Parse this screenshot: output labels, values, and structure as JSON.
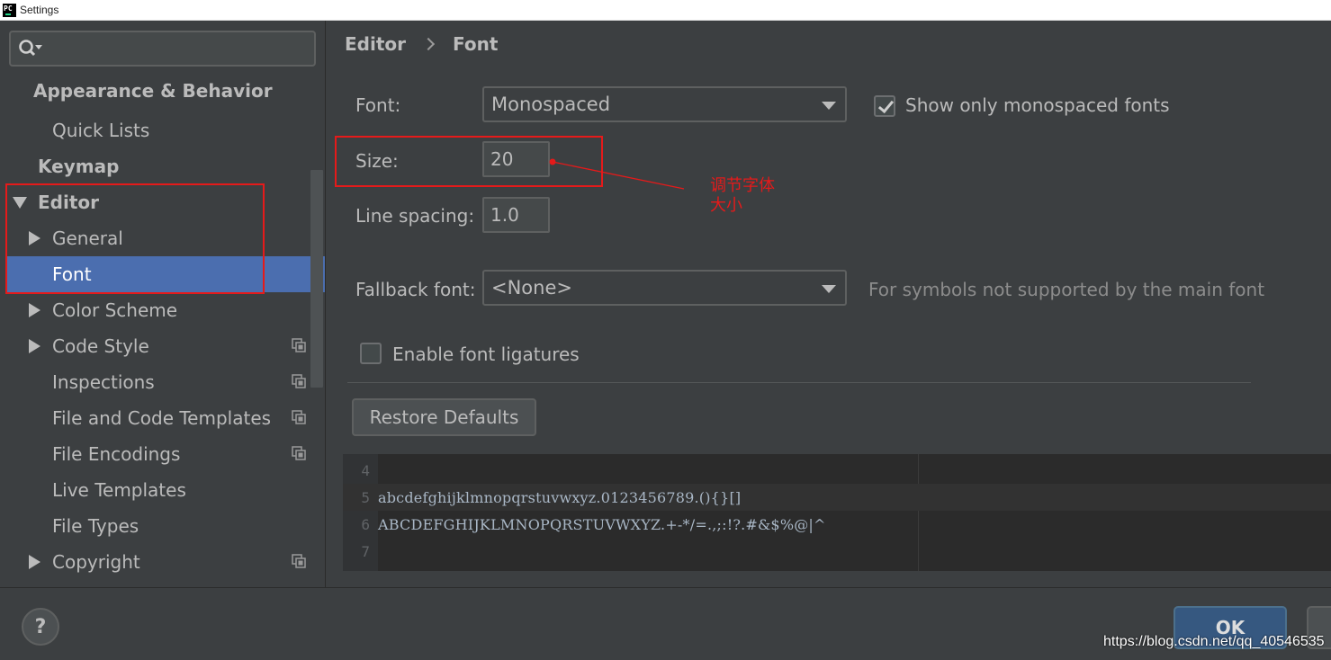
{
  "window": {
    "title": "Settings",
    "logo_text": "PC"
  },
  "sidebar": {
    "search": {
      "placeholder": "",
      "icon": "search-icon"
    },
    "items": [
      {
        "label": "Appearance & Behavior",
        "type": "group",
        "expanded": false
      },
      {
        "label": "Quick Lists",
        "type": "item"
      },
      {
        "label": "Keymap",
        "type": "group"
      },
      {
        "label": "Editor",
        "type": "group",
        "expanded": true
      },
      {
        "label": "General",
        "type": "item",
        "expandable": true
      },
      {
        "label": "Font",
        "type": "item",
        "selected": true
      },
      {
        "label": "Color Scheme",
        "type": "item",
        "expandable": true
      },
      {
        "label": "Code Style",
        "type": "item",
        "expandable": true,
        "project_icon": true
      },
      {
        "label": "Inspections",
        "type": "item",
        "project_icon": true
      },
      {
        "label": "File and Code Templates",
        "type": "item",
        "project_icon": true
      },
      {
        "label": "File Encodings",
        "type": "item",
        "project_icon": true
      },
      {
        "label": "Live Templates",
        "type": "item"
      },
      {
        "label": "File Types",
        "type": "item"
      },
      {
        "label": "Copyright",
        "type": "item",
        "expandable": true,
        "project_icon": true
      }
    ]
  },
  "breadcrumb": [
    "Editor",
    "Font"
  ],
  "font_settings": {
    "font_label": "Font:",
    "font_value": "Monospaced",
    "monospaced_only_label": "Show only monospaced fonts",
    "monospaced_only_checked": true,
    "size_label": "Size:",
    "size_value": "20",
    "line_spacing_label": "Line spacing:",
    "line_spacing_value": "1.0",
    "fallback_label": "Fallback font:",
    "fallback_value": "<None>",
    "fallback_hint": "For symbols not supported by the main font",
    "ligatures_label": "Enable font ligatures",
    "ligatures_checked": false,
    "restore_label": "Restore Defaults"
  },
  "preview": {
    "lines": [
      {
        "num": "4",
        "text": ""
      },
      {
        "num": "5",
        "text": "abcdefghijklmnopqrstuvwxyz.0123456789.(){}[]"
      },
      {
        "num": "6",
        "text": "ABCDEFGHIJKLMNOPQRSTUVWXYZ.+-*/=.,;:!?.#&$%@|^"
      },
      {
        "num": "7",
        "text": ""
      }
    ]
  },
  "annotation": {
    "line1": "调节字体",
    "line2": "大小",
    "color": "#e51a1a"
  },
  "footer": {
    "help_label": "?",
    "ok_label": "OK",
    "watermark": "https://blog.csdn.net/qq_40546535"
  },
  "colors": {
    "background": "#3c3f41",
    "selection": "#4b6eaf",
    "text": "#bbbbbb",
    "accent_button": "#365880"
  }
}
